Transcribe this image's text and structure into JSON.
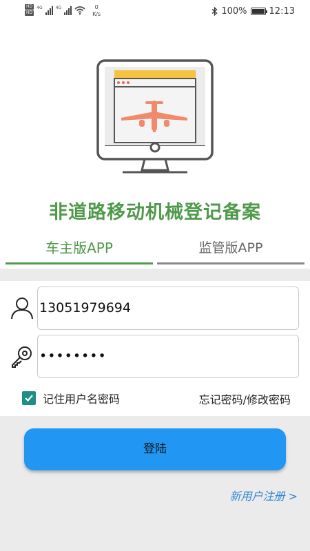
{
  "status_bar": {
    "hd_label_1": "HD",
    "hd_label_2": "HD",
    "network_1": "4G",
    "network_2": "4G",
    "speed_value": "0",
    "speed_unit": "K/s",
    "battery_percent": "100%",
    "time": "12:13",
    "battery_level": 1.0
  },
  "illustration": {
    "icon": "monitor-airplane-icon",
    "colors": {
      "frame": "#555555",
      "accent": "#f5c242",
      "plane": "#ef8a6c",
      "screen": "#f2f2f2"
    }
  },
  "app_title": "非道路移动机械登记备案",
  "tabs": [
    {
      "label": "车主版APP",
      "active": true
    },
    {
      "label": "监管版APP",
      "active": false
    }
  ],
  "login_form": {
    "phone_value": "13051979694",
    "password_masked": "••••••••",
    "remember_label": "记住用户名密码",
    "remember_checked": true,
    "forgot_label": "忘记密码/修改密码",
    "login_label": "登陆",
    "register_label": "新用户注册 >"
  },
  "colors": {
    "title_green": "#4f9a4a",
    "button_blue": "#2196f3",
    "link_blue": "#2f86d6",
    "checkbox_teal": "#1f8f86"
  }
}
